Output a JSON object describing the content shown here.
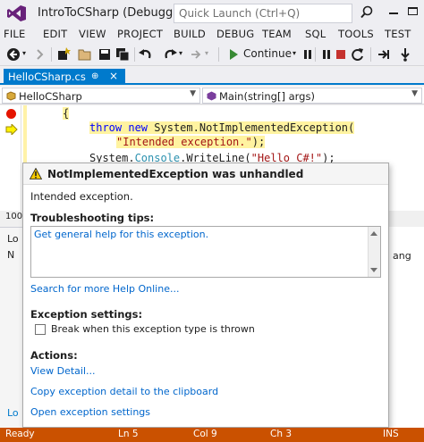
{
  "titlebar": {
    "title": "IntroToCSharp (Debugging)",
    "quick_launch_placeholder": "Quick Launch (Ctrl+Q)"
  },
  "menu": [
    "FILE",
    "EDIT",
    "VIEW",
    "PROJECT",
    "BUILD",
    "DEBUG",
    "TEAM",
    "SQL",
    "TOOLS",
    "TEST"
  ],
  "toolbar": {
    "continue_label": "Continue",
    "icons": [
      "back-icon",
      "forward-icon",
      "new-project-icon",
      "open-icon",
      "save-icon",
      "save-all-icon",
      "undo-icon",
      "redo-icon",
      "continue-icon",
      "pause-icon",
      "stop-icon",
      "restart-icon"
    ]
  },
  "tab": {
    "label": "HelloCSharp.cs",
    "pin": "⊕",
    "close": "×"
  },
  "navbar": {
    "class_combo": "HelloCSharp",
    "member_combo": "Main(string[] args)"
  },
  "code": {
    "brace": "{",
    "throw_kw": "throw",
    "throw_new": "new",
    "throw_rest": "System.NotImplementedException(",
    "throw_arg": "\"Intended exception.\"",
    "throw_end": ");",
    "console_prefix": "System.",
    "console_type": "Console",
    "console_method": ".WriteLine(",
    "console_arg": "\"Hello C#!\"",
    "console_end": ");"
  },
  "background": {
    "zoom": "100",
    "lower_tab_1": "Lo",
    "lower_tab_2": "N",
    "lower_tab_3": "Lo",
    "right_text": "ang"
  },
  "exception": {
    "title": "NotImplementedException was unhandled",
    "message": "Intended exception.",
    "tips_heading": "Troubleshooting tips:",
    "tip_link": "Get general help for this exception.",
    "search_link": "Search for more Help Online...",
    "settings_heading": "Exception settings:",
    "break_checkbox_label": "Break when this exception type is thrown",
    "break_checked": false,
    "actions_heading": "Actions:",
    "actions": [
      "View Detail...",
      "Copy exception detail to the clipboard",
      "Open exception settings"
    ]
  },
  "statusbar": {
    "state": "Ready",
    "line": "Ln 5",
    "col": "Col 9",
    "ch": "Ch 3",
    "mode": "INS",
    "color": "#ca5100"
  }
}
